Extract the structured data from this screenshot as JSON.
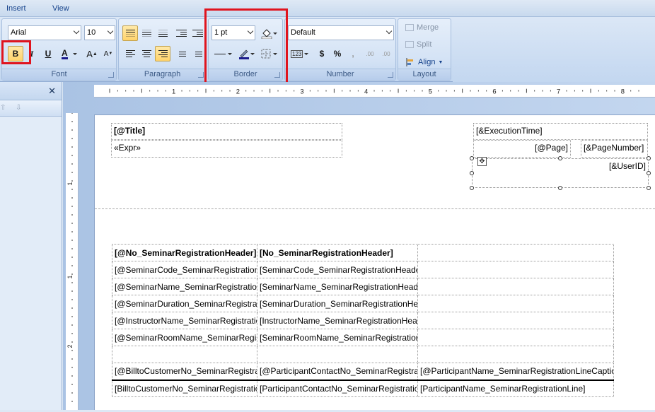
{
  "menu": {
    "insert": "Insert",
    "view": "View"
  },
  "font_group": {
    "font_name": "Arial",
    "font_size": "10",
    "caption": "Font",
    "bold": "B",
    "italic": "I",
    "underline": "U",
    "font_color": "A",
    "grow": "A",
    "shrink": "A"
  },
  "paragraph_group": {
    "caption": "Paragraph"
  },
  "border_group": {
    "width": "1 pt",
    "caption": "Border"
  },
  "number_group": {
    "format": "Default",
    "caption": "Number",
    "currency": "$",
    "percent": "%",
    "comma": ",",
    "numbers": "123",
    "inc_decimal": ".00",
    "dec_decimal": ".00"
  },
  "layout_group": {
    "merge": "Merge",
    "split": "Split",
    "align": "Align",
    "caption": "Layout"
  },
  "left_panel": {
    "close": "✕"
  },
  "ruler": {
    "h_labels": [
      "1",
      "2",
      "3",
      "4",
      "5",
      "6",
      "7",
      "8"
    ],
    "v_labels": [
      "1",
      "1",
      "2"
    ]
  },
  "header_boxes": {
    "title": "[@Title]",
    "expr": "«Expr»",
    "exec_time": "[&ExecutionTime]",
    "page": "[@Page]",
    "page_number": "[&PageNumber]",
    "user_id": "[&UserID]"
  },
  "table": {
    "rows": [
      [
        "[@No_SeminarRegistrationHeader]",
        "[No_SeminarRegistrationHeader]",
        ""
      ],
      [
        "[@SeminarCode_SeminarRegistrationHeader]",
        "[SeminarCode_SeminarRegistrationHeader]",
        ""
      ],
      [
        "[@SeminarName_SeminarRegistrationHeader]",
        "[SeminarName_SeminarRegistrationHeader]",
        ""
      ],
      [
        "[@SeminarDuration_SeminarRegistrationHeader]",
        "[SeminarDuration_SeminarRegistrationHeader]",
        ""
      ],
      [
        "[@InstructorName_SeminarRegistrationHeader]",
        "[InstructorName_SeminarRegistrationHeader]",
        ""
      ],
      [
        "[@SeminarRoomName_SeminarRegistrationHeader]",
        "[SeminarRoomName_SeminarRegistrationHeader]",
        ""
      ],
      [
        "",
        "",
        ""
      ],
      [
        "[@BilltoCustomerNo_SeminarRegistrationLine]",
        "[@ParticipantContactNo_SeminarRegistrationLine]",
        "[@ParticipantName_SeminarRegistrationLineCaption]"
      ],
      [
        "[BilltoCustomerNo_SeminarRegistrationLine]",
        "[ParticipantContactNo_SeminarRegistrationLine]",
        "[ParticipantName_SeminarRegistrationLine]"
      ]
    ]
  },
  "colors": {
    "highlight": "#e0141e",
    "ribbon": "#c3d7f0",
    "active_button": "#ffd36b"
  }
}
